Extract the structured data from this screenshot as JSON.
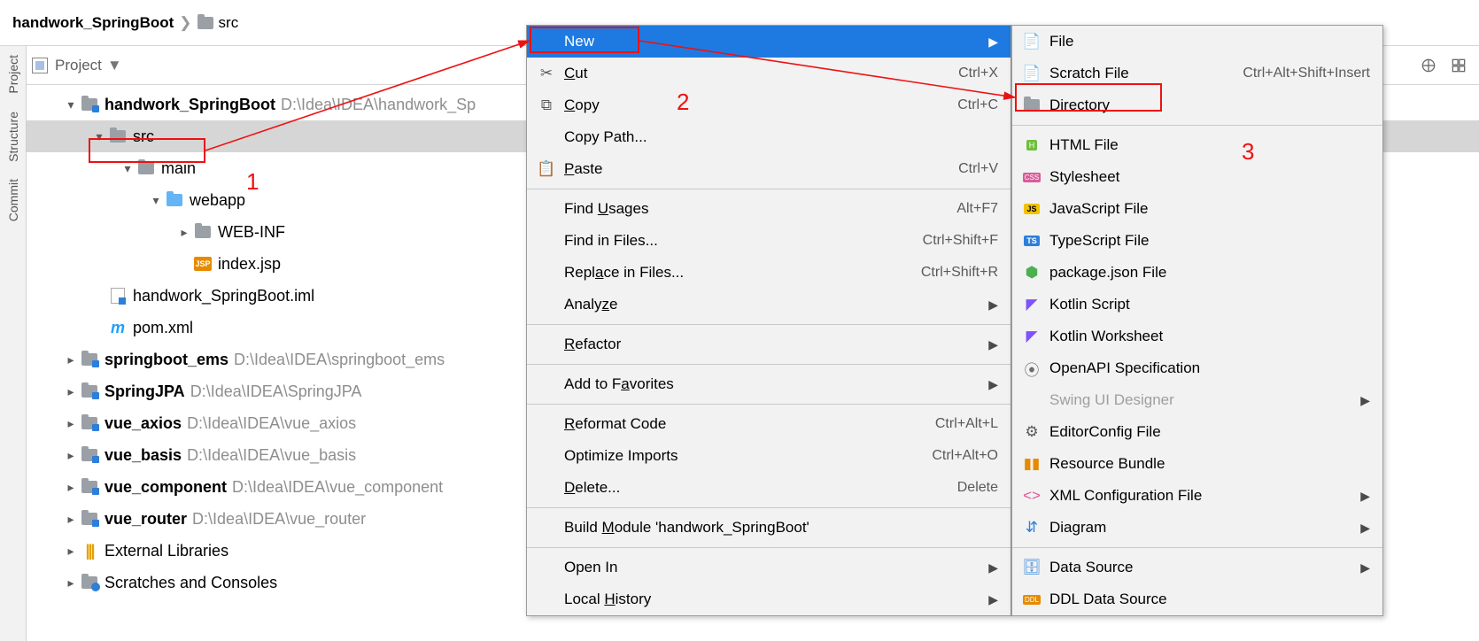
{
  "breadcrumb": {
    "root": "handwork_SpringBoot",
    "node": "src"
  },
  "panel": {
    "title": "Project"
  },
  "rail": {
    "project": "Project",
    "structure": "Structure",
    "commit": "Commit"
  },
  "tree": {
    "root": {
      "name": "handwork_SpringBoot",
      "path": "D:\\Idea\\IDEA\\handwork_Sp"
    },
    "src": "src",
    "main": "main",
    "webapp": "webapp",
    "webinf": "WEB-INF",
    "indexjsp": "index.jsp",
    "jsp_badge": "JSP",
    "iml": "handwork_SpringBoot.iml",
    "pom": "pom.xml",
    "pom_m": "m",
    "p2": {
      "name": "springboot_ems",
      "path": "D:\\Idea\\IDEA\\springboot_ems"
    },
    "p3": {
      "name": "SpringJPA",
      "path": "D:\\Idea\\IDEA\\SpringJPA"
    },
    "p4": {
      "name": "vue_axios",
      "path": "D:\\Idea\\IDEA\\vue_axios"
    },
    "p5": {
      "name": "vue_basis",
      "path": "D:\\Idea\\IDEA\\vue_basis"
    },
    "p6": {
      "name": "vue_component",
      "path": "D:\\Idea\\IDEA\\vue_component"
    },
    "p7": {
      "name": "vue_router",
      "path": "D:\\Idea\\IDEA\\vue_router"
    },
    "extlib": "External Libraries",
    "scratches": "Scratches and Consoles"
  },
  "ctx": {
    "new": "New",
    "cut": {
      "pre": "",
      "u": "C",
      "post": "ut",
      "short": "Ctrl+X"
    },
    "copy": {
      "pre": "",
      "u": "C",
      "post": "opy",
      "short": "Ctrl+C"
    },
    "copypath": "Copy Path...",
    "paste": {
      "pre": "",
      "u": "P",
      "post": "aste",
      "short": "Ctrl+V"
    },
    "findu": {
      "pre": "Find ",
      "u": "U",
      "post": "sages",
      "short": "Alt+F7"
    },
    "findf": {
      "label": "Find in Files...",
      "short": "Ctrl+Shift+F"
    },
    "replf": {
      "pre": "Repl",
      "u": "a",
      "post": "ce in Files...",
      "short": "Ctrl+Shift+R"
    },
    "analyze": {
      "pre": "Analy",
      "u": "z",
      "post": "e"
    },
    "refactor": {
      "pre": "",
      "u": "R",
      "post": "efactor"
    },
    "addfav": {
      "pre": "Add to F",
      "u": "a",
      "post": "vorites"
    },
    "reformat": {
      "pre": "",
      "u": "R",
      "post": "eformat Code",
      "short": "Ctrl+Alt+L"
    },
    "optimp": {
      "label": "Optimize Imports",
      "short": "Ctrl+Alt+O"
    },
    "delete": {
      "pre": "",
      "u": "D",
      "post": "elete...",
      "short": "Delete"
    },
    "buildm": {
      "pre": "Build ",
      "u": "M",
      "post": "odule 'handwork_SpringBoot'"
    },
    "openin": "Open In",
    "localh": {
      "pre": "Local ",
      "u": "H",
      "post": "istory"
    }
  },
  "newmenu": {
    "file": "File",
    "scratch": {
      "label": "Scratch File",
      "short": "Ctrl+Alt+Shift+Insert"
    },
    "directory": "Directory",
    "html": "HTML File",
    "stylesheet": "Stylesheet",
    "js": "JavaScript File",
    "ts": "TypeScript File",
    "pkg": "package.json File",
    "kts": "Kotlin Script",
    "ktws": "Kotlin Worksheet",
    "openapi": "OpenAPI Specification",
    "swing": "Swing UI Designer",
    "editorconfig": "EditorConfig File",
    "resbundle": "Resource Bundle",
    "xmlconf": "XML Configuration File",
    "diagram": "Diagram",
    "datasource": "Data Source",
    "ddl": "DDL Data Source",
    "jsbadge": "JS",
    "tsbadge": "TS",
    "htmlbadge": "H",
    "cssbadge": "CSS",
    "ddlbadge": "DDL"
  },
  "anno": {
    "n1": "1",
    "n2": "2",
    "n3": "3"
  }
}
